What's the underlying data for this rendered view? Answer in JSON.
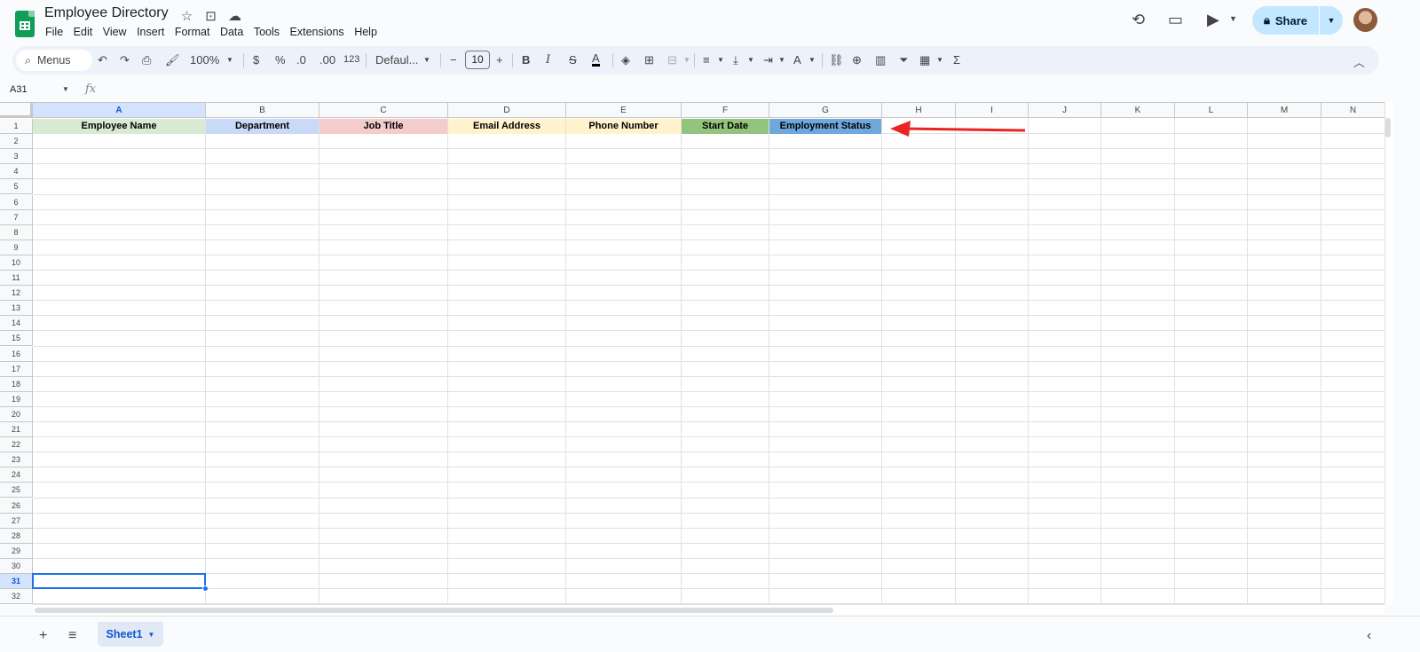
{
  "app": {
    "title": "Employee Directory",
    "menus": [
      "File",
      "Edit",
      "View",
      "Insert",
      "Format",
      "Data",
      "Tools",
      "Extensions",
      "Help"
    ],
    "share_label": "Share"
  },
  "toolbar": {
    "search_label": "Menus",
    "zoom": "100%",
    "currency": "$",
    "percent": "%",
    "dec_decrease": ".0",
    "dec_increase": ".00",
    "number_format": "123",
    "font": "Defaul...",
    "font_size": "10",
    "bold": "B",
    "italic": "I",
    "strike": "S",
    "text_color": "A",
    "sigma": "Σ"
  },
  "formula_bar": {
    "name_box": "A31",
    "fx": "fx"
  },
  "grid": {
    "columns": [
      "A",
      "B",
      "C",
      "D",
      "E",
      "F",
      "G",
      "H",
      "I",
      "J",
      "K",
      "L",
      "M",
      "N"
    ],
    "selected_column": "A",
    "selected_row": 31,
    "rows": [
      "1",
      "2",
      "3",
      "4",
      "5",
      "6",
      "7",
      "8",
      "9",
      "10",
      "11",
      "12",
      "13",
      "14",
      "15",
      "16",
      "17",
      "18",
      "19",
      "20",
      "21",
      "22",
      "23",
      "24",
      "25",
      "26",
      "27",
      "28",
      "29",
      "30",
      "31",
      "32"
    ],
    "header_row": [
      {
        "text": "Employee Name",
        "bg": "#d9ead3"
      },
      {
        "text": "Department",
        "bg": "#c9daf8"
      },
      {
        "text": "Job Title",
        "bg": "#f4cccc"
      },
      {
        "text": "Email Address",
        "bg": "#fff2cc"
      },
      {
        "text": "Phone Number",
        "bg": "#fff2cc"
      },
      {
        "text": "Start Date",
        "bg": "#93c47d"
      },
      {
        "text": "Employment Status",
        "bg": "#6fa8dc"
      }
    ]
  },
  "annotation": {
    "arrow_color": "#e8251f"
  },
  "sheets": {
    "tabs": [
      "Sheet1"
    ]
  }
}
